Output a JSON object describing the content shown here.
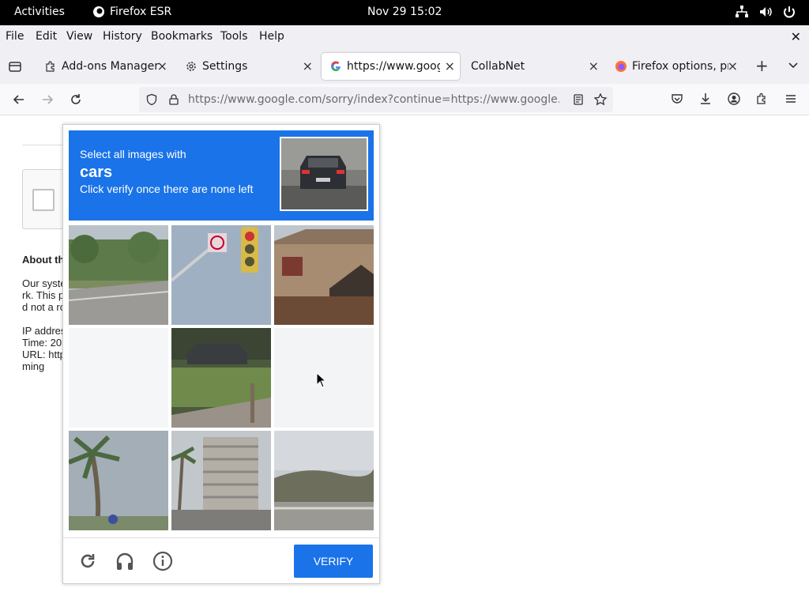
{
  "system_bar": {
    "activities": "Activities",
    "app_name": "Firefox ESR",
    "clock": "Nov 29  15:02"
  },
  "menu": {
    "items": [
      "File",
      "Edit",
      "View",
      "History",
      "Bookmarks",
      "Tools",
      "Help"
    ]
  },
  "tabs": [
    {
      "label": "Add-ons Manager",
      "icon": "puzzle-icon"
    },
    {
      "label": "Settings",
      "icon": "gear-icon"
    },
    {
      "label": "https://www.goog",
      "icon": "google-icon",
      "active": true
    },
    {
      "label": "CollabNet",
      "icon": ""
    },
    {
      "label": "Firefox options, pr",
      "icon": "firefox-icon"
    }
  ],
  "navbar": {
    "url": "https://www.google.com/sorry/index?continue=https://www.google."
  },
  "page": {
    "about_heading": "About th",
    "para1": "Our syste\nrk. This p\nd not a ro",
    "para2": "IP addres\nTime: 20\nURL: http\nming"
  },
  "captcha": {
    "line1": "Select all images with",
    "target": "cars",
    "line3": "Click verify once there are none left",
    "verify_label": "VERIFY",
    "tiles": [
      "street-with-trees",
      "traffic-light-sign",
      "house-roof",
      "blank-tile",
      "car-in-grass",
      "blank-tile",
      "palm-tree",
      "building-street",
      "road-hills"
    ]
  },
  "colors": {
    "captcha_blue": "#1a73e8",
    "top_bar": "#000000",
    "chrome_bg": "#f0f0f4"
  }
}
